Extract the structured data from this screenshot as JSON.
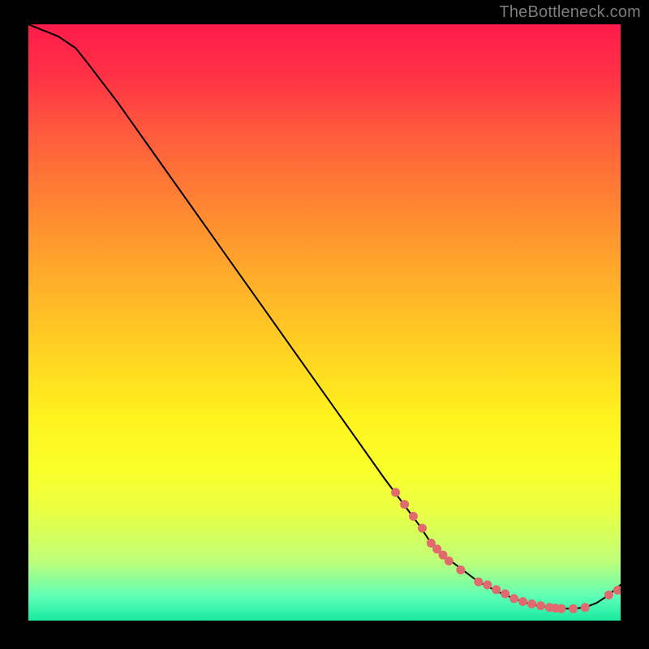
{
  "watermark": "TheBottleneck.com",
  "colors": {
    "background": "#000000",
    "watermark_text": "#7d7d7d",
    "curve": "#000000",
    "marker": "#e06a6e",
    "gradient_stops": [
      "#ff1b4a",
      "#ff2f46",
      "#ff5a3d",
      "#ff8433",
      "#ffab2a",
      "#ffd322",
      "#fff31e",
      "#f9ff2a",
      "#e8ff45",
      "#bfff79",
      "#5dffb7",
      "#19e9a0"
    ]
  },
  "chart_data": {
    "type": "line",
    "title": "",
    "xlabel": "",
    "ylabel": "",
    "xlim": [
      0,
      100
    ],
    "ylim": [
      0,
      100
    ],
    "x": [
      0,
      2,
      5,
      8,
      10,
      15,
      20,
      25,
      30,
      35,
      40,
      45,
      50,
      55,
      60,
      63,
      66,
      68,
      70,
      72,
      74,
      76,
      78,
      80,
      82,
      84,
      86,
      88,
      90,
      92,
      94,
      96,
      98,
      100,
      102,
      104
    ],
    "y": [
      100,
      99.2,
      98.0,
      96.0,
      93.5,
      87.0,
      80.0,
      73.0,
      66.0,
      59.0,
      52.0,
      45.0,
      38.0,
      31.0,
      24.0,
      20.0,
      16.0,
      13.0,
      11.0,
      9.5,
      8.0,
      6.5,
      5.5,
      4.5,
      3.7,
      3.0,
      2.5,
      2.2,
      2.0,
      2.0,
      2.2,
      3.0,
      4.3,
      6.0,
      8.0,
      10.0
    ],
    "markers": {
      "x": [
        62,
        63.5,
        65,
        66.5,
        68,
        69,
        70,
        71,
        73,
        76,
        77.5,
        79,
        80.5,
        82,
        83.5,
        85,
        86.5,
        88,
        89,
        90,
        92,
        94,
        98,
        99.5,
        103,
        104
      ],
      "y": [
        21.5,
        19.5,
        17.5,
        15.5,
        13.0,
        12.0,
        11.0,
        10.0,
        8.5,
        6.5,
        6.0,
        5.2,
        4.5,
        3.7,
        3.2,
        2.8,
        2.5,
        2.2,
        2.1,
        2.0,
        2.0,
        2.2,
        4.3,
        5.1,
        8.5,
        10.0
      ]
    }
  }
}
